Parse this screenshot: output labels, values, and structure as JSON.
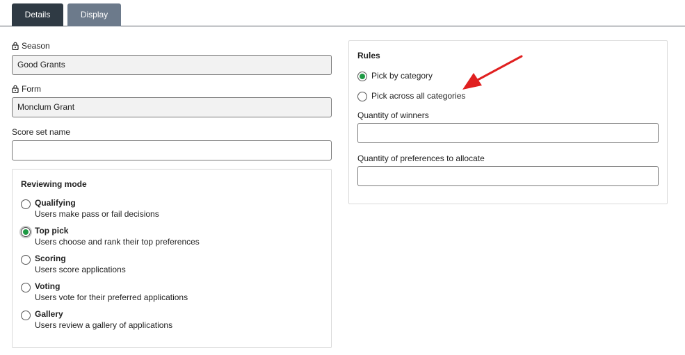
{
  "tabs": [
    {
      "label": "Details",
      "active": true
    },
    {
      "label": "Display",
      "active": false
    }
  ],
  "fields": {
    "season": {
      "label": "Season",
      "value": "Good Grants",
      "locked": true
    },
    "form": {
      "label": "Form",
      "value": "Monclum Grant",
      "locked": true
    },
    "score_set_name": {
      "label": "Score set name",
      "value": ""
    }
  },
  "reviewing_mode": {
    "title": "Reviewing mode",
    "options": [
      {
        "title": "Qualifying",
        "desc": "Users make pass or fail decisions",
        "selected": false
      },
      {
        "title": "Top pick",
        "desc": "Users choose and rank their top preferences",
        "selected": true
      },
      {
        "title": "Scoring",
        "desc": "Users score applications",
        "selected": false
      },
      {
        "title": "Voting",
        "desc": "Users vote for their preferred applications",
        "selected": false
      },
      {
        "title": "Gallery",
        "desc": "Users review a gallery of applications",
        "selected": false
      }
    ]
  },
  "rules": {
    "title": "Rules",
    "options": [
      {
        "label": "Pick by category",
        "selected": true
      },
      {
        "label": "Pick across all categories",
        "selected": false
      }
    ],
    "quantity_winners": {
      "label": "Quantity of winners",
      "value": ""
    },
    "quantity_preferences": {
      "label": "Quantity of preferences to allocate",
      "value": ""
    }
  },
  "colors": {
    "tab_active": "#2f3a44",
    "tab_inactive": "#6c7a8b",
    "radio_selected": "#1f9a45",
    "annotation_arrow": "#e02020"
  },
  "icons": {
    "lock": "lock-icon",
    "arrow": "red-arrow-annotation"
  }
}
